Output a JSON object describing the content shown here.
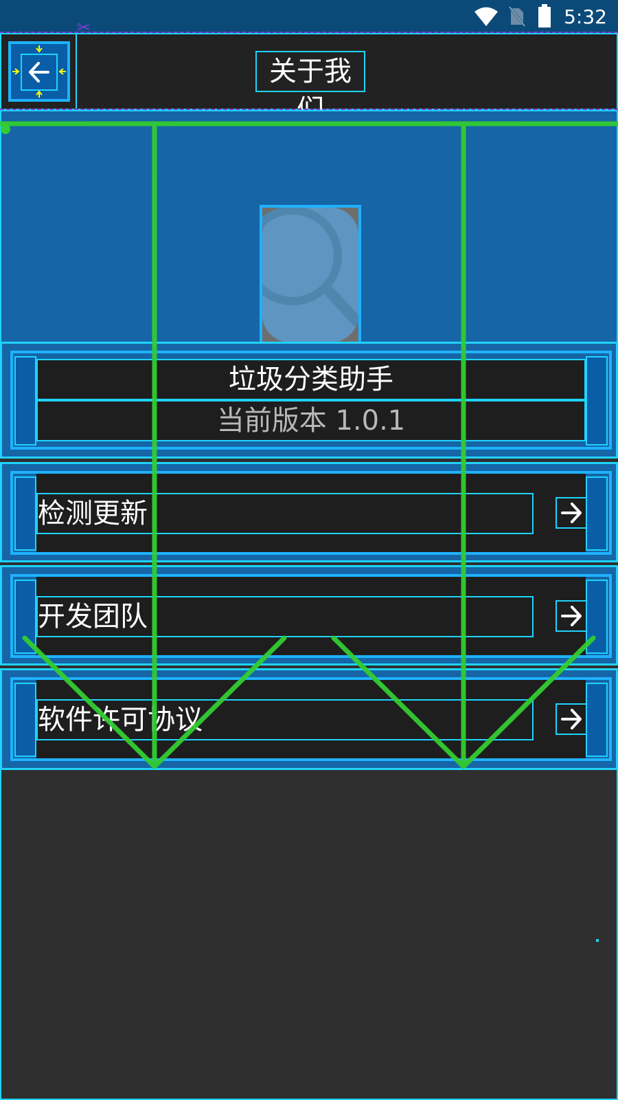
{
  "status_bar": {
    "time": "5:32",
    "icons": [
      "wifi-icon",
      "no-sim-icon",
      "battery-icon"
    ]
  },
  "toolbar": {
    "title": "关于我们",
    "back_icon": "arrow-left-icon"
  },
  "app_info": {
    "name": "垃圾分类助手",
    "version": "当前版本 1.0.1",
    "logo_icon": "magnifier-icon"
  },
  "menu": [
    {
      "label": "检测更新",
      "icon": "arrow-right-icon"
    },
    {
      "label": "开发团队",
      "icon": "arrow-right-icon"
    },
    {
      "label": "软件许可协议",
      "icon": "arrow-right-icon"
    }
  ],
  "colors": {
    "status_bar": "#0b4a78",
    "toolbar_bg": "#222222",
    "panel_blue": "#1565a7",
    "outline_cyan": "#1fd3ff",
    "guide_green": "#33cc33",
    "page_bg": "#2f2f2f"
  }
}
